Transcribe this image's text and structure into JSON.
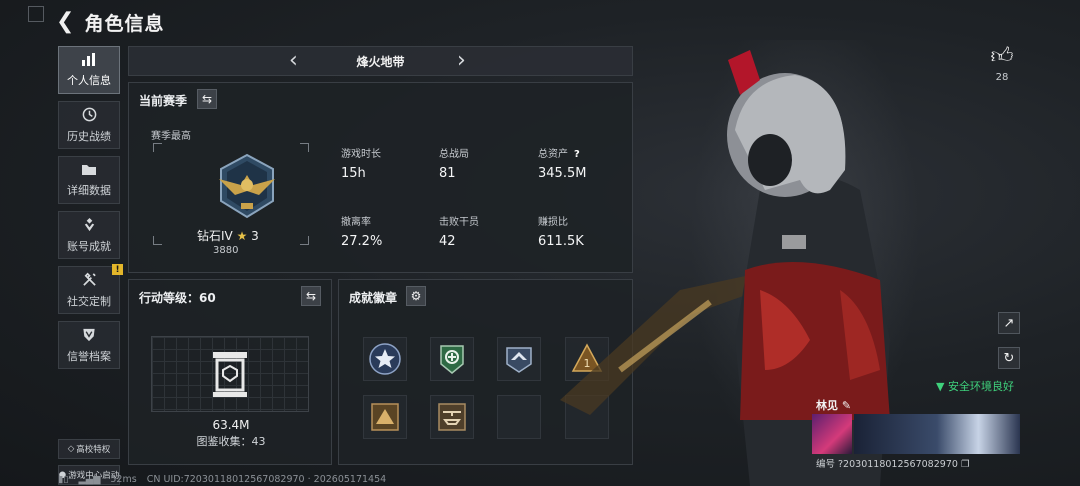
{
  "header": {
    "back_icon": "back-arrow-icon",
    "title": "角色信息"
  },
  "sidebar": {
    "items": [
      {
        "label": "个人信息",
        "icon": "bar-chart-icon",
        "active": true
      },
      {
        "label": "历史战绩",
        "icon": "clock-icon"
      },
      {
        "label": "详细数据",
        "icon": "folder-icon"
      },
      {
        "label": "账号成就",
        "icon": "achievement-icon"
      },
      {
        "label": "社交定制",
        "icon": "tools-icon",
        "badge": "!"
      },
      {
        "label": "信誉档案",
        "icon": "shield-icon"
      }
    ],
    "campus": "高校特权",
    "game_center": "游戏中心启动"
  },
  "map_selector": {
    "current": "烽火地带"
  },
  "season": {
    "title": "当前赛季",
    "season_high": "赛季最高",
    "rank_name": "钻石IV",
    "rank_stars": "3",
    "rank_score": "3880",
    "stats": [
      {
        "label": "游戏时长",
        "value": "15h"
      },
      {
        "label": "总战局",
        "value": "81"
      },
      {
        "label": "总资产",
        "value": "345.5M",
        "help": "?"
      },
      {
        "label": "撤离率",
        "value": "27.2%"
      },
      {
        "label": "击败干员",
        "value": "42"
      },
      {
        "label": "赚损比",
        "value": "611.5K"
      }
    ]
  },
  "level": {
    "title": "行动等级：60",
    "value": "63.4M",
    "collection": "图鉴收集：43"
  },
  "badges": {
    "title": "成就徽章",
    "slots": 8
  },
  "right_panel": {
    "likes": "28",
    "safe_env": "安全环境良好",
    "player_name": "林见",
    "player_uid": "编号 ?2030118012567082970"
  },
  "status_bar": {
    "ping": "52ms",
    "cn_uid": "CN UID:72030118012567082970 · 202605171454"
  },
  "colors": {
    "accent_green": "#3fd17c",
    "star_gold": "#e6c148",
    "badge_yellow": "#e3b62a"
  }
}
